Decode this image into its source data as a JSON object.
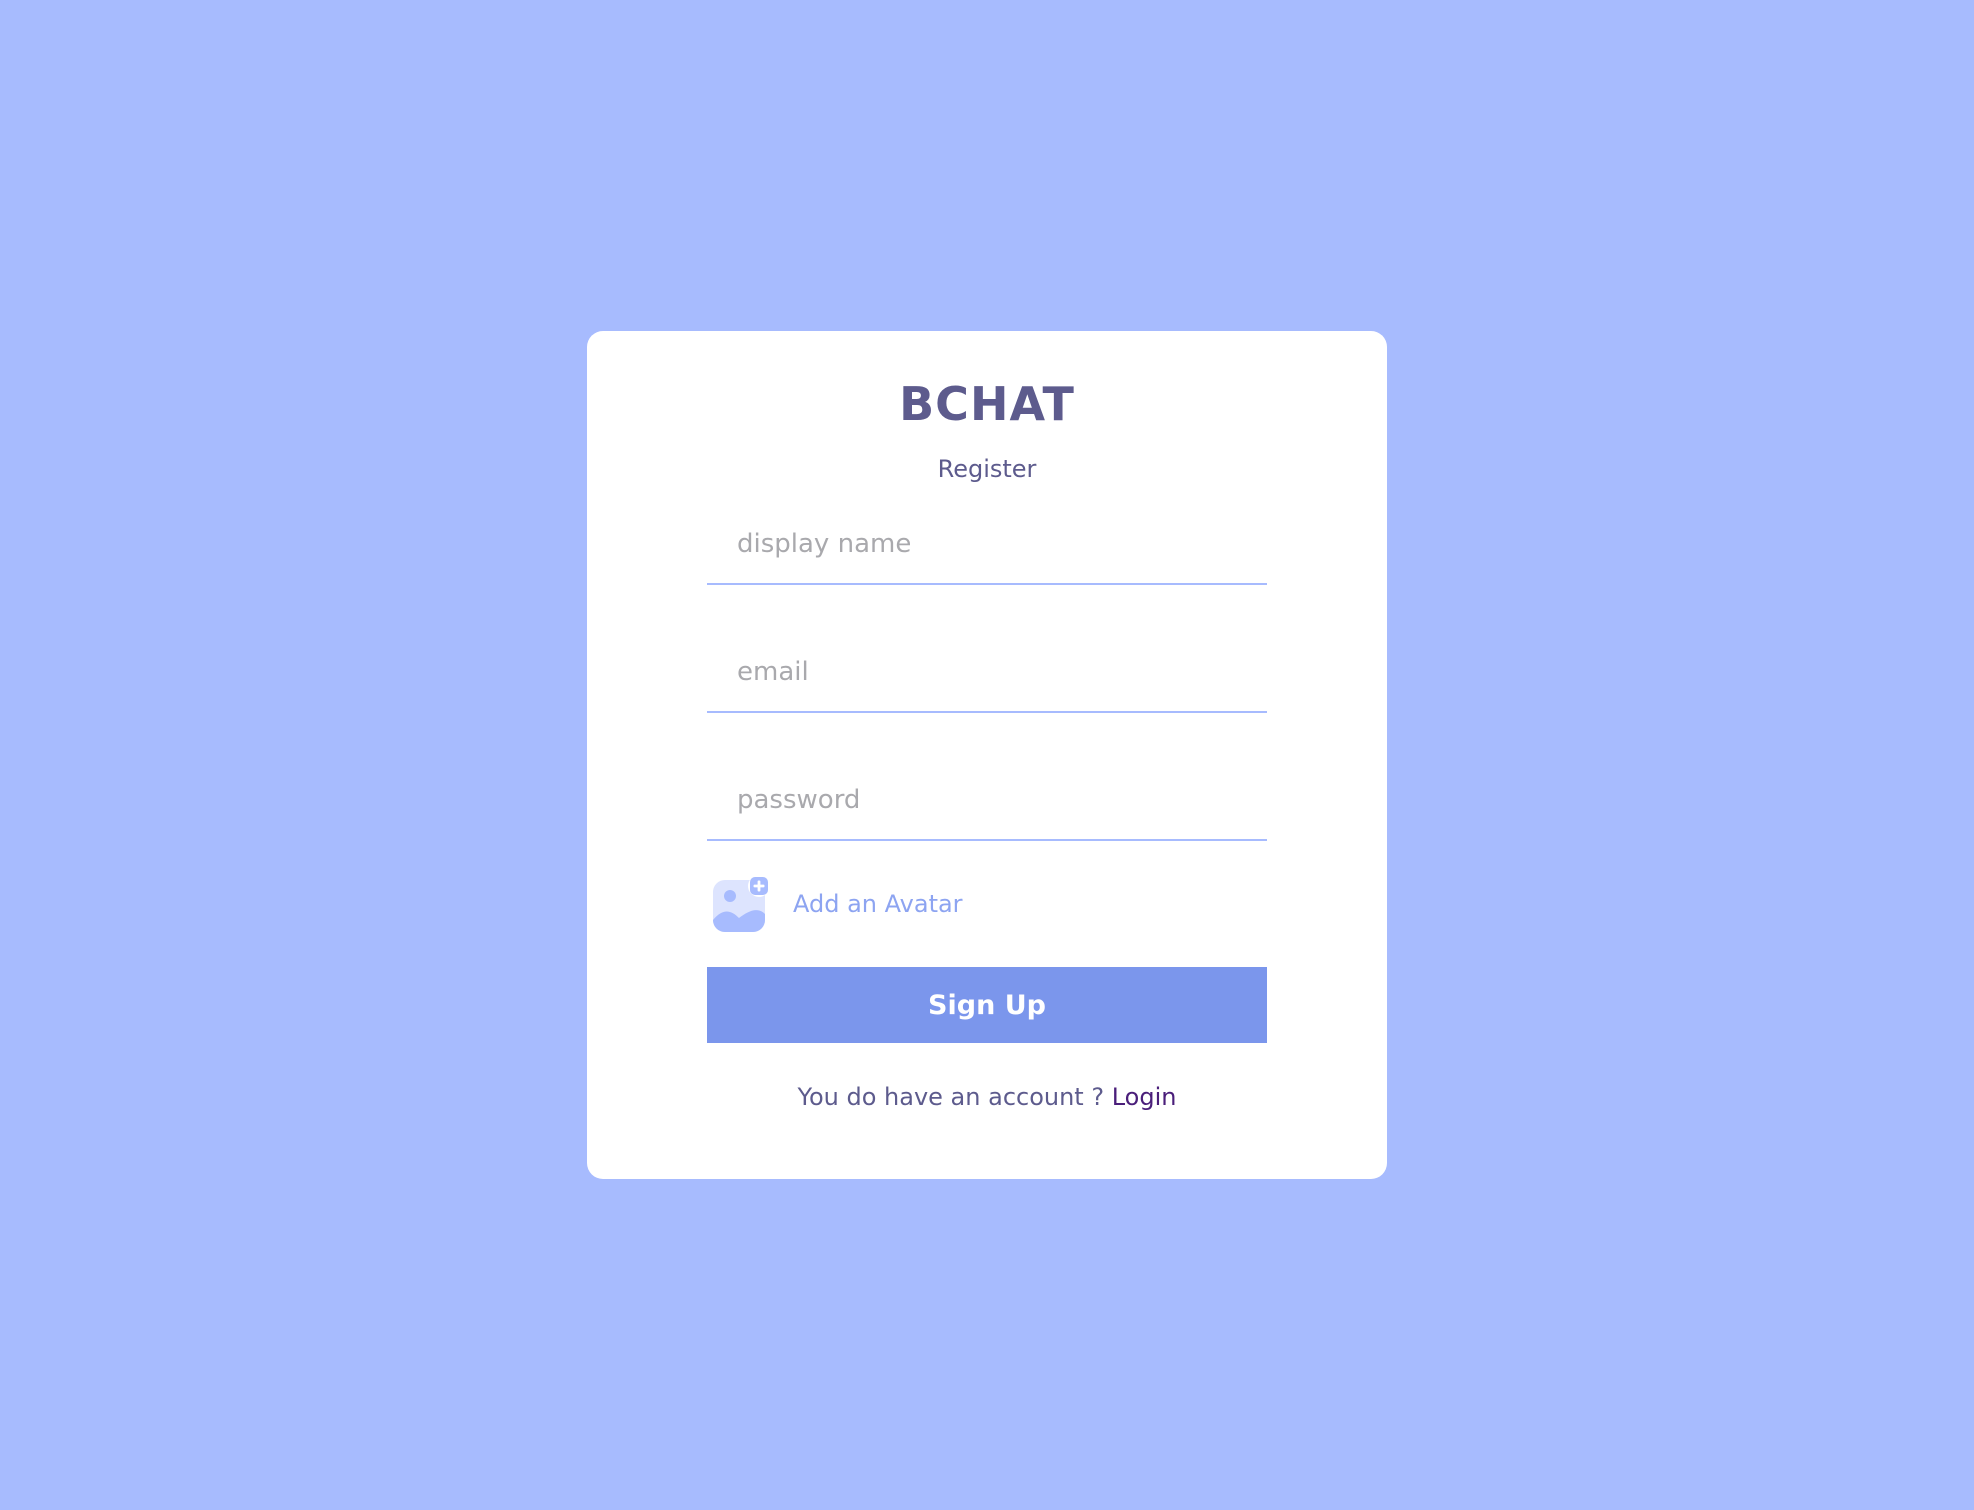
{
  "app": {
    "logo": "BCHAT",
    "subtitle": "Register"
  },
  "form": {
    "display_name": {
      "value": "",
      "placeholder": "display name"
    },
    "email": {
      "value": "",
      "placeholder": "email"
    },
    "password": {
      "value": "",
      "placeholder": "password"
    },
    "avatar": {
      "label": "Add an Avatar",
      "icon": "add-image-icon"
    },
    "submit_label": "Sign Up"
  },
  "footer": {
    "prompt": "You do have an account ?",
    "login_label": "Login"
  },
  "colors": {
    "background": "#a7bbfe",
    "brand_text": "#5d5b8d",
    "button": "#7b96ec",
    "link": "#4a1e7a"
  }
}
